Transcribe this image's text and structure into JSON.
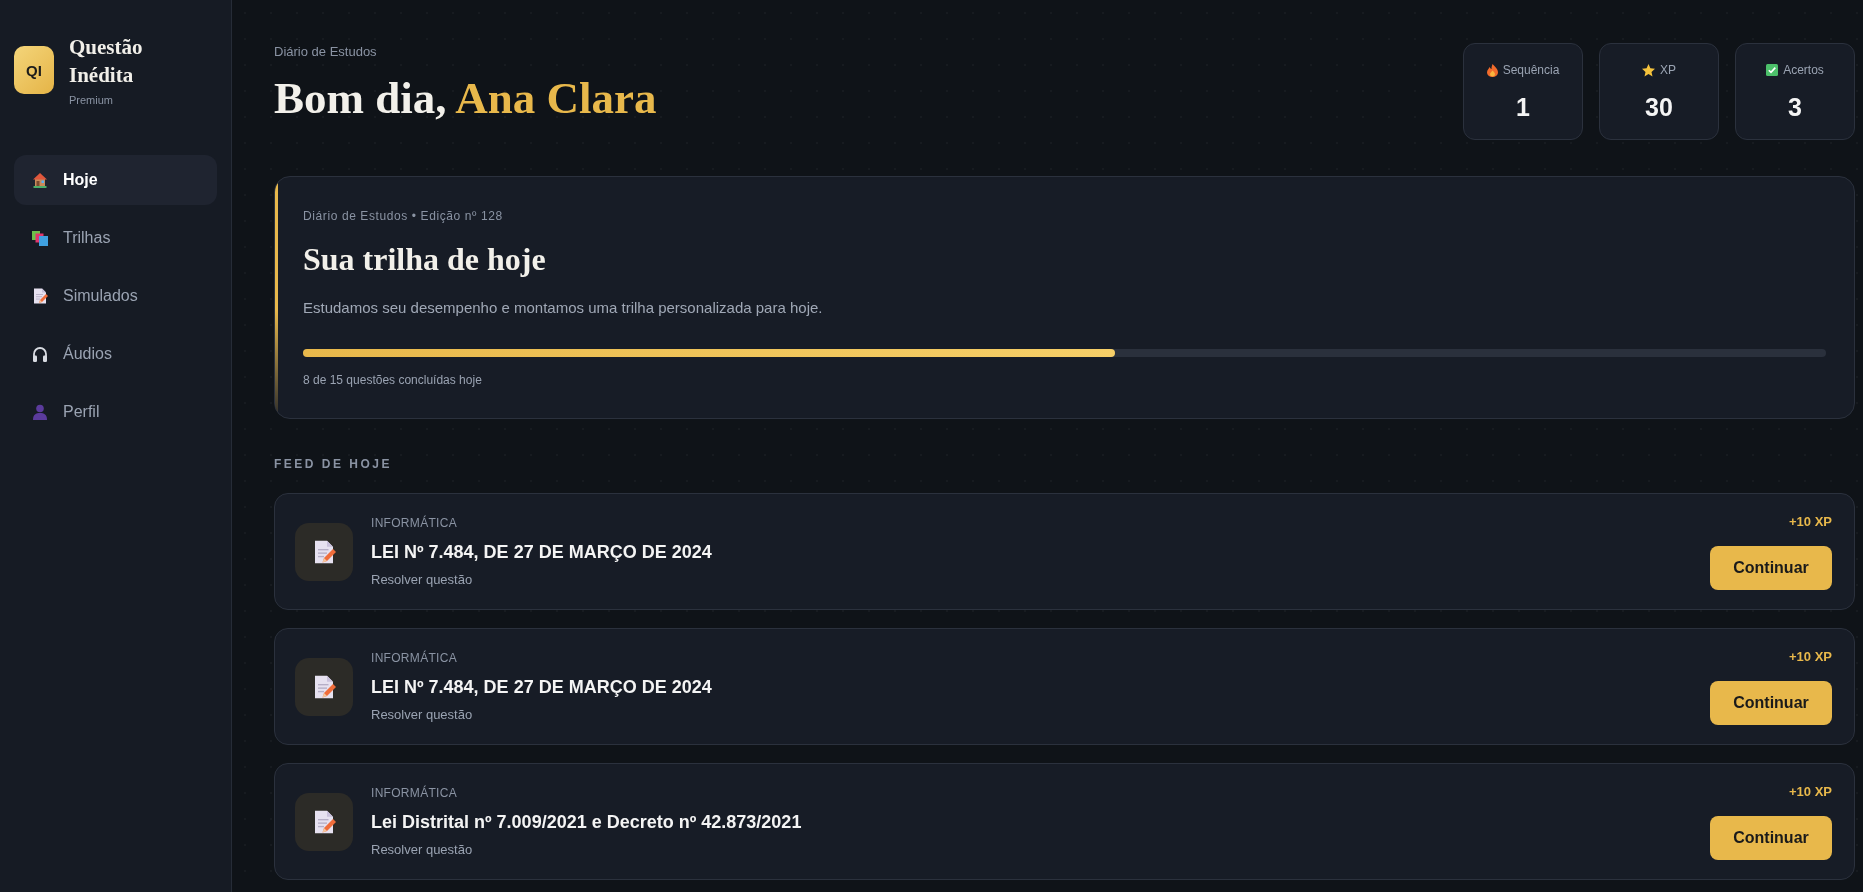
{
  "sidebar": {
    "logo": "QI",
    "brand": "Questão Inédita",
    "plan": "Premium",
    "nav": [
      {
        "label": "Hoje",
        "selected": true
      },
      {
        "label": "Trilhas",
        "selected": false
      },
      {
        "label": "Simulados",
        "selected": false
      },
      {
        "label": "Áudios",
        "selected": false
      },
      {
        "label": "Perfil",
        "selected": false
      }
    ]
  },
  "header": {
    "eyebrow": "Diário de Estudos",
    "greeting": "Bom dia,",
    "user_name": "Ana Clara"
  },
  "stats": [
    {
      "label": "Sequência",
      "value": "1"
    },
    {
      "label": "XP",
      "value": "30"
    },
    {
      "label": "Acertos",
      "value": "3"
    }
  ],
  "hero": {
    "meta": "Diário de Estudos • Edição nº 128",
    "title": "Sua trilha de hoje",
    "description": "Estudamos seu desempenho e montamos uma trilha personalizada para hoje.",
    "progress": {
      "level": 0.533,
      "caption": "8 de 15 questões concluídas hoje"
    }
  },
  "feed": {
    "heading": "FEED DE HOJE",
    "items": [
      {
        "category": "INFORMÁTICA",
        "title": "LEI Nº 7.484, DE 27 DE MARÇO DE 2024",
        "action": "Resolver questão",
        "xp": "+10 XP",
        "button": "Continuar"
      },
      {
        "category": "INFORMÁTICA",
        "title": "LEI Nº 7.484, DE 27 DE MARÇO DE 2024",
        "action": "Resolver questão",
        "xp": "+10 XP",
        "button": "Continuar"
      },
      {
        "category": "INFORMÁTICA",
        "title": "Lei Distrital nº 7.009/2021 e Decreto nº 42.873/2021",
        "action": "Resolver questão",
        "xp": "+10 XP",
        "button": "Continuar"
      }
    ]
  }
}
